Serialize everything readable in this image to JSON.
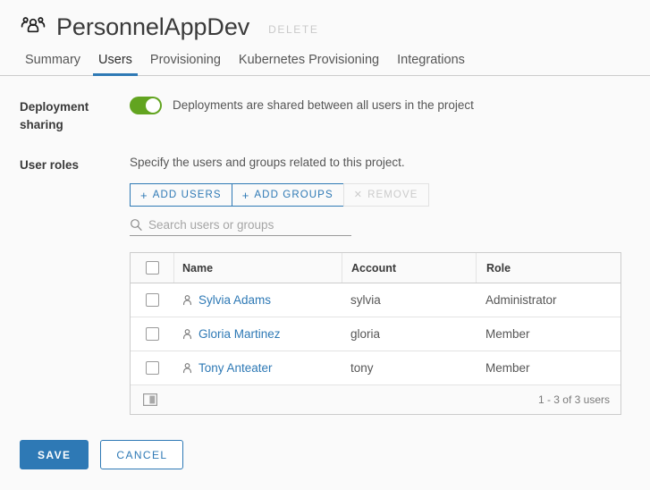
{
  "header": {
    "icon": "users-group-icon",
    "title": "PersonnelAppDev",
    "delete_label": "DELETE"
  },
  "tabs": [
    {
      "label": "Summary",
      "active": false
    },
    {
      "label": "Users",
      "active": true
    },
    {
      "label": "Provisioning",
      "active": false
    },
    {
      "label": "Kubernetes Provisioning",
      "active": false
    },
    {
      "label": "Integrations",
      "active": false
    }
  ],
  "deployment_sharing": {
    "label": "Deployment sharing",
    "toggle_on": true,
    "toggle_color": "#62a420",
    "description": "Deployments are shared between all users in the project"
  },
  "user_roles": {
    "label": "User roles",
    "hint": "Specify the users and groups related to this project.",
    "buttons": [
      {
        "label": "ADD USERS",
        "icon": "plus-icon",
        "disabled": false
      },
      {
        "label": "ADD GROUPS",
        "icon": "plus-icon",
        "disabled": false
      },
      {
        "label": "REMOVE",
        "icon": "close-icon",
        "disabled": true
      }
    ],
    "search_placeholder": "Search users or groups",
    "search_value": ""
  },
  "table": {
    "columns": [
      "Name",
      "Account",
      "Role"
    ],
    "rows": [
      {
        "name": "Sylvia Adams",
        "account": "sylvia",
        "role": "Administrator",
        "selected": false
      },
      {
        "name": "Gloria Martinez",
        "account": "gloria",
        "role": "Member",
        "selected": false
      },
      {
        "name": "Tony Anteater",
        "account": "tony",
        "role": "Member",
        "selected": false
      }
    ],
    "footer_count": "1 - 3 of 3 users",
    "footer_icon": "columns-icon"
  },
  "footer": {
    "save_label": "SAVE",
    "cancel_label": "CANCEL",
    "accent_color": "#2e79b5"
  }
}
